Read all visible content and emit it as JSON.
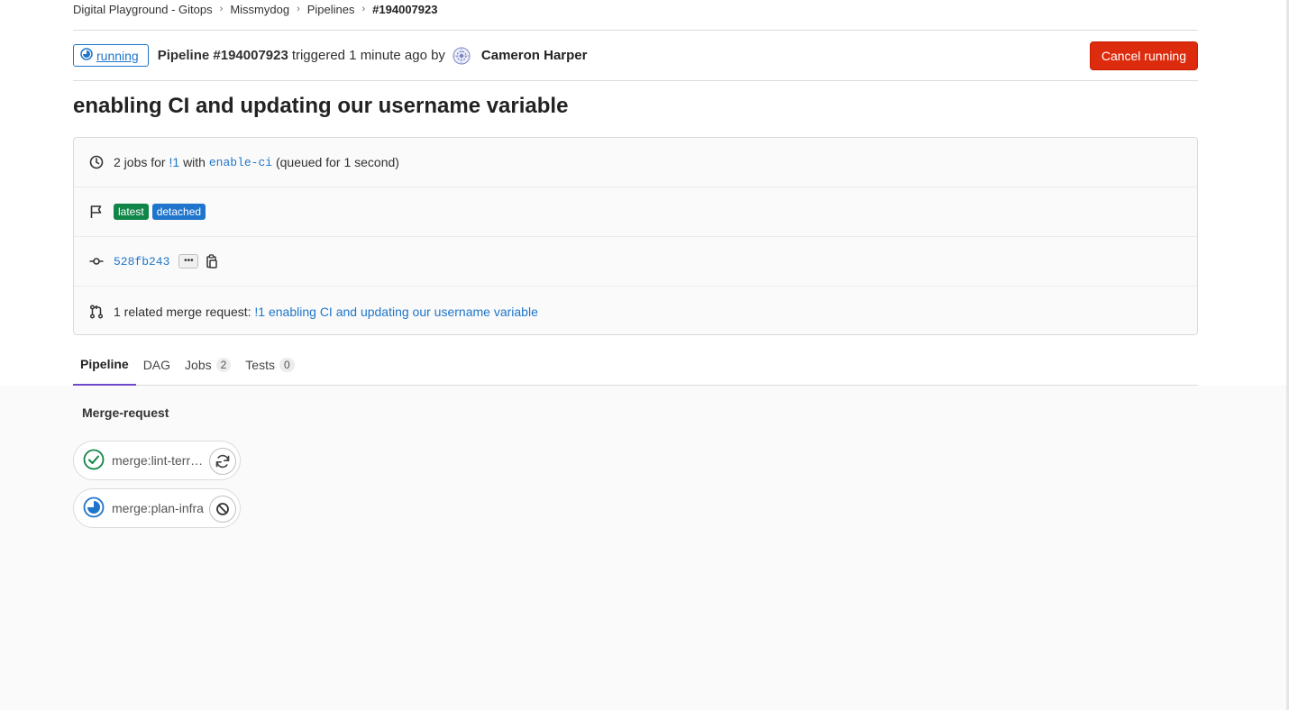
{
  "breadcrumb": {
    "items": [
      "Digital Playground - Gitops",
      "Missmydog",
      "Pipelines"
    ],
    "current": "#194007923"
  },
  "header": {
    "status": "running",
    "pipeline_label": "Pipeline #194007923",
    "triggered_text": "triggered 1 minute ago by",
    "author": "Cameron Harper",
    "cancel_button": "Cancel running"
  },
  "title": "enabling CI and updating our username variable",
  "info": {
    "jobs_prefix": "2 jobs for",
    "mr_ref": "!1",
    "with_text": "with",
    "branch": "enable-ci",
    "queued_text": "(queued for 1 second)",
    "tags": [
      "latest",
      "detached"
    ],
    "commit_sha": "528fb243",
    "ellipsis": "•••",
    "mr_prefix": "1 related merge request:",
    "mr_link": "!1 enabling CI and updating our username variable"
  },
  "tabs": [
    {
      "label": "Pipeline",
      "count": null
    },
    {
      "label": "DAG",
      "count": null
    },
    {
      "label": "Jobs",
      "count": "2"
    },
    {
      "label": "Tests",
      "count": "0"
    }
  ],
  "stage": {
    "title": "Merge-request",
    "jobs": [
      {
        "name": "merge:lint-terraform",
        "status": "success",
        "action": "retry"
      },
      {
        "name": "merge:plan-infra",
        "status": "running",
        "action": "cancel"
      }
    ]
  },
  "colors": {
    "running": "#1f75cb",
    "success": "#108548",
    "danger": "#dd2b0e",
    "active_tab": "#6e49cb"
  }
}
